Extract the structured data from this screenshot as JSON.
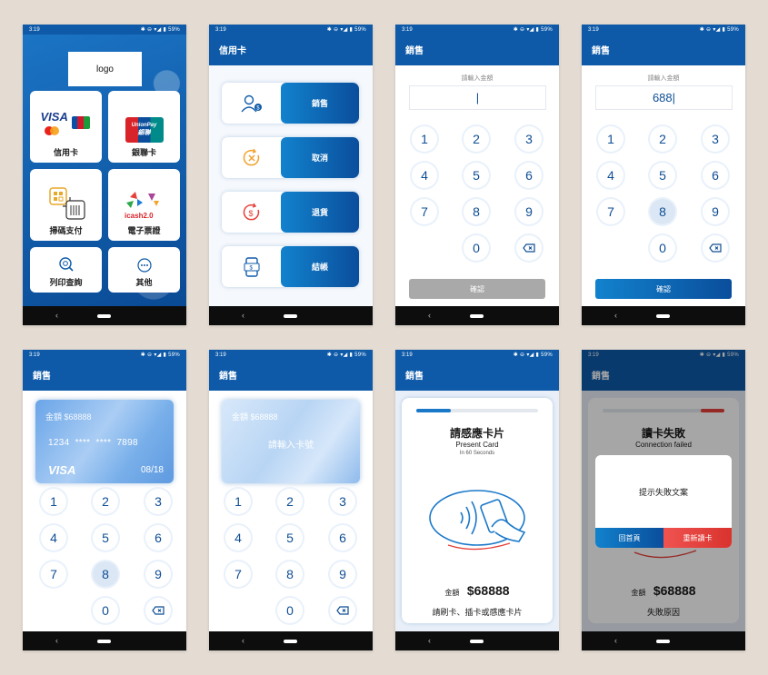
{
  "status": {
    "time": "3:19",
    "icons": "✱ ⊖ ▾◢ ▮ 59%"
  },
  "screen1": {
    "logo": "logo",
    "tiles": [
      {
        "label": "信用卡"
      },
      {
        "label": "銀聯卡"
      },
      {
        "label": "掃碼支付"
      },
      {
        "label": "電子票證"
      },
      {
        "label": "列印查詢"
      },
      {
        "label": "其他"
      }
    ],
    "visa_text": "VISA",
    "unionpay_text": "UnionPay",
    "unionpay_sub": "銀聯",
    "icash_text": "icash2.0"
  },
  "screen2": {
    "title": "信用卡",
    "items": [
      {
        "label": "銷售"
      },
      {
        "label": "取消"
      },
      {
        "label": "退貨"
      },
      {
        "label": "結帳"
      }
    ]
  },
  "screen3": {
    "title": "銷售",
    "input_label": "請輸入金額",
    "input_value": "|",
    "keys": [
      "1",
      "2",
      "3",
      "4",
      "5",
      "6",
      "7",
      "8",
      "9",
      "0"
    ],
    "confirm": "確認"
  },
  "screen4": {
    "title": "銷售",
    "input_label": "請輸入金額",
    "input_value": "688|",
    "confirm": "確認"
  },
  "screen5": {
    "title": "銷售",
    "card_amount": "金額 $68888",
    "card_number": "1234  ****  ****  7898",
    "card_brand": "VISA",
    "card_expiry": "08/18"
  },
  "screen6": {
    "title": "銷售",
    "card_amount": "金額 $68888",
    "card_prompt": "請輸入卡號"
  },
  "screen7": {
    "title": "銷售",
    "heading": "請感應卡片",
    "sub_en": "Present Card",
    "timer": "In 60 Seconds",
    "amount_label": "金額",
    "amount": "$68888",
    "instruction": "請刷卡、插卡或感應卡片",
    "progress": 0.28
  },
  "screen8": {
    "title": "銷售",
    "heading": "讀卡失敗",
    "sub_en": "Connection failed",
    "dialog_text": "提示失敗文案",
    "btn_home": "回首頁",
    "btn_retry": "重新讀卡",
    "amount_label": "金額",
    "amount": "$68888",
    "reason": "失敗原因"
  },
  "nav": {
    "back": "‹"
  },
  "colors": {
    "primary": "#0e5aa8",
    "accent_red": "#e5403a"
  }
}
